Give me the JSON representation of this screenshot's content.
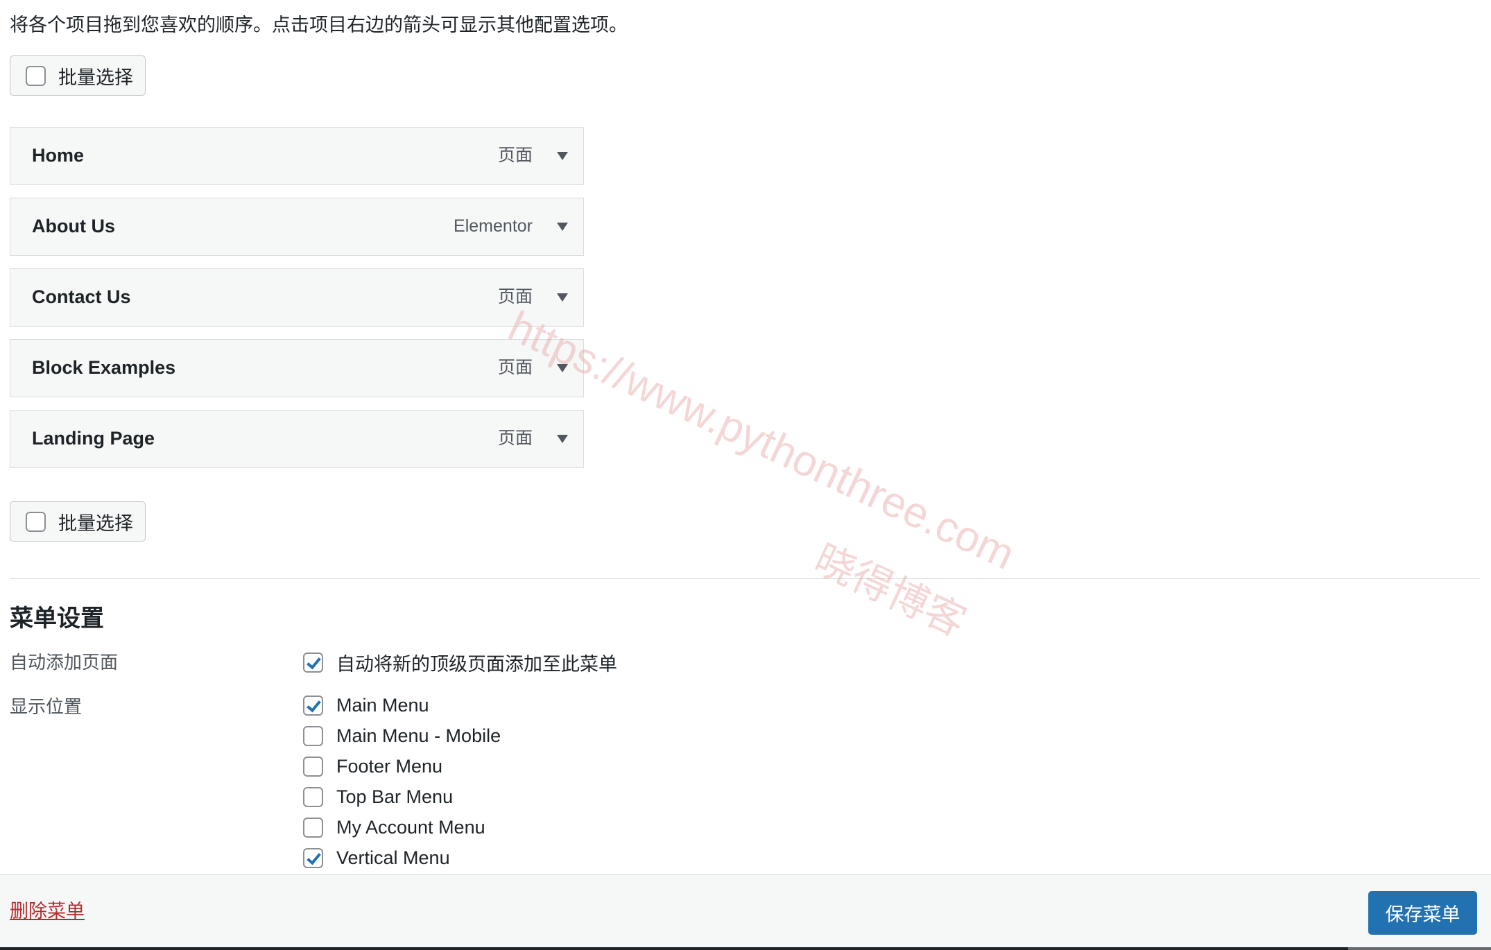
{
  "instructions": "将各个项目拖到您喜欢的顺序。点击项目右边的箭头可显示其他配置选项。",
  "bulk_select_label": "批量选择",
  "menu_items": [
    {
      "title": "Home",
      "type": "页面"
    },
    {
      "title": "About Us",
      "type": "Elementor"
    },
    {
      "title": "Contact Us",
      "type": "页面"
    },
    {
      "title": "Block Examples",
      "type": "页面"
    },
    {
      "title": "Landing Page",
      "type": "页面"
    }
  ],
  "settings": {
    "title": "菜单设置",
    "auto_add": {
      "label": "自动添加页面",
      "option": {
        "text": "自动将新的顶级页面添加至此菜单",
        "checked": true
      }
    },
    "locations": {
      "label": "显示位置",
      "options": [
        {
          "text": "Main Menu",
          "checked": true
        },
        {
          "text": "Main Menu - Mobile",
          "checked": false
        },
        {
          "text": "Footer Menu",
          "checked": false
        },
        {
          "text": "Top Bar Menu",
          "checked": false
        },
        {
          "text": "My Account Menu",
          "checked": false
        },
        {
          "text": "Vertical Menu",
          "checked": true
        }
      ]
    }
  },
  "footer": {
    "delete_label": "删除菜单",
    "save_label": "保存菜单"
  },
  "watermark": {
    "url": "https://www.pythonthree.com",
    "name": "晓得博客"
  },
  "colors": {
    "accent": "#2271b1",
    "danger": "#b32d2e",
    "watermark": "#e8a6a6"
  }
}
